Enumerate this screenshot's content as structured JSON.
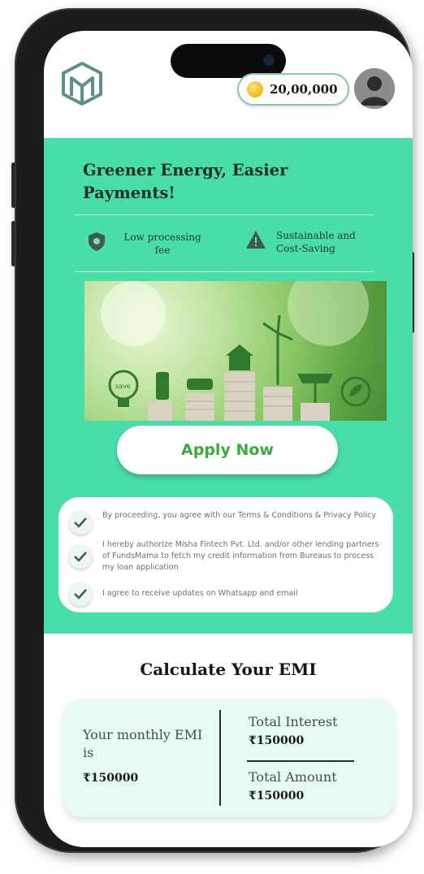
{
  "header": {
    "coin_balance": "20,00,000"
  },
  "hero": {
    "title": "Greener Energy, Easier Payments!",
    "features": [
      {
        "icon": "shield-icon",
        "text": "Low processing fee"
      },
      {
        "icon": "warning-triangle-icon",
        "text": "Sustainable and Cost-Saving"
      }
    ],
    "banner_icon": "green-energy-coins-illustration",
    "apply_label": "Apply Now"
  },
  "consents": [
    {
      "text": "By proceeding, you agree with our Terms & Conditions & Privacy Policy",
      "checked": true
    },
    {
      "text": "I hereby authorize Misha Fintech Pvt. Ltd. and/or other lending partners of FundsMama to fetch my credit information from Bureaus to process my loan application",
      "checked": true
    },
    {
      "text": "I agree to receive updates on Whatsapp and email",
      "checked": true
    }
  ],
  "emi": {
    "section_title": "Calculate Your EMI",
    "monthly_label": "Your monthly EMI is",
    "monthly_value": "₹150000",
    "interest_label": "Total Interest",
    "interest_value": "₹150000",
    "amount_label": "Total Amount",
    "amount_value": "₹150000"
  },
  "colors": {
    "hero_bg": "#49dda8",
    "apply_text": "#3daa3d",
    "emi_card_bg": "#e5fbf3"
  }
}
